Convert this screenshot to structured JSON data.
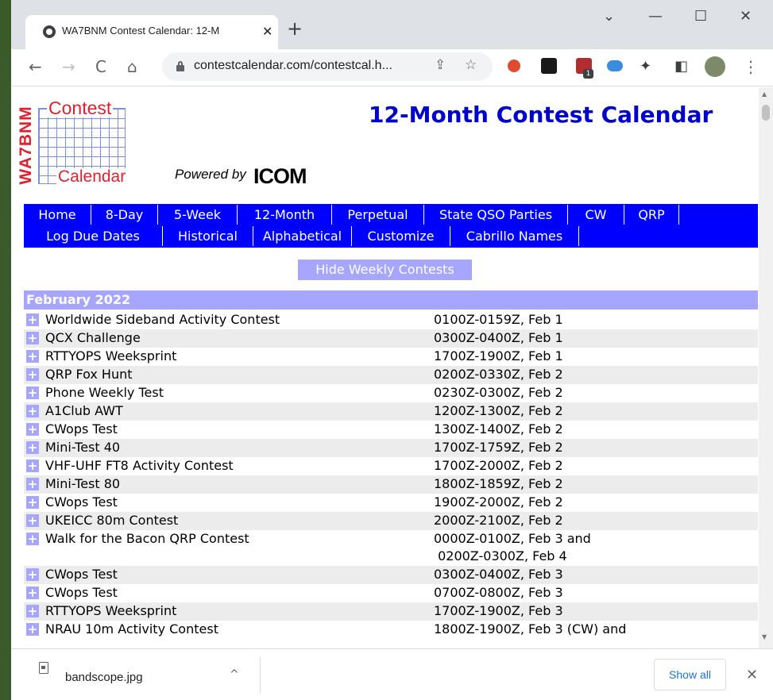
{
  "browser": {
    "tab_title": "WA7BNM Contest Calendar: 12-M",
    "tab_close": "✕",
    "new_tab": "+",
    "minimize": "—",
    "maximize": "☐",
    "close": "✕",
    "back": "←",
    "forward": "→",
    "reload": "C",
    "home": "⌂",
    "url": "contestcalendar.com/contestcal.h...",
    "share": "⇪",
    "bookmark": "☆",
    "puzzle": "✦",
    "sidepanel": "◧",
    "menu": "⋮",
    "ext_badge": "1"
  },
  "logo": {
    "top_word": "Contest",
    "bottom_word": "Calendar",
    "vertical_word": "WA7BNM",
    "powered_by": "Powered by",
    "brand": "ICOM"
  },
  "page_title": "12-Month Contest Calendar",
  "nav": {
    "row1": [
      "Home",
      "8-Day",
      "5-Week",
      "12-Month",
      "Perpetual",
      "State QSO Parties",
      "CW",
      "QRP"
    ],
    "row2": [
      "Log Due Dates",
      "Historical",
      "Alphabetical",
      "Customize",
      "Cabrillo Names"
    ]
  },
  "hide_button": "Hide Weekly Contests",
  "month_header": "February 2022",
  "expander_symbol": "+",
  "contests": [
    {
      "name": "Worldwide Sideband Activity Contest",
      "time": "0100Z-0159Z, Feb 1"
    },
    {
      "name": "QCX Challenge",
      "time": "0300Z-0400Z, Feb 1"
    },
    {
      "name": "RTTYOPS Weeksprint",
      "time": "1700Z-1900Z, Feb 1"
    },
    {
      "name": "QRP Fox Hunt",
      "time": "0200Z-0330Z, Feb 2"
    },
    {
      "name": "Phone Weekly Test",
      "time": "0230Z-0300Z, Feb 2"
    },
    {
      "name": "A1Club AWT",
      "time": "1200Z-1300Z, Feb 2"
    },
    {
      "name": "CWops Test",
      "time": "1300Z-1400Z, Feb 2"
    },
    {
      "name": "Mini-Test 40",
      "time": "1700Z-1759Z, Feb 2"
    },
    {
      "name": "VHF-UHF FT8 Activity Contest",
      "time": "1700Z-2000Z, Feb 2"
    },
    {
      "name": "Mini-Test 80",
      "time": "1800Z-1859Z, Feb 2"
    },
    {
      "name": "CWops Test",
      "time": "1900Z-2000Z, Feb 2"
    },
    {
      "name": "UKEICC 80m Contest",
      "time": "2000Z-2100Z, Feb 2"
    },
    {
      "name": "Walk for the Bacon QRP Contest",
      "time": "0000Z-0100Z, Feb 3 and\n 0200Z-0300Z, Feb 4"
    },
    {
      "name": "CWops Test",
      "time": "0300Z-0400Z, Feb 3"
    },
    {
      "name": "CWops Test",
      "time": "0700Z-0800Z, Feb 3"
    },
    {
      "name": "RTTYOPS Weeksprint",
      "time": "1700Z-1900Z, Feb 3"
    },
    {
      "name": "NRAU 10m Activity Contest",
      "time": "1800Z-1900Z, Feb 3 (CW) and"
    }
  ],
  "downloads": {
    "file_name": "bandscope.jpg",
    "chevron": "^",
    "show_all": "Show all",
    "close": "✕"
  }
}
